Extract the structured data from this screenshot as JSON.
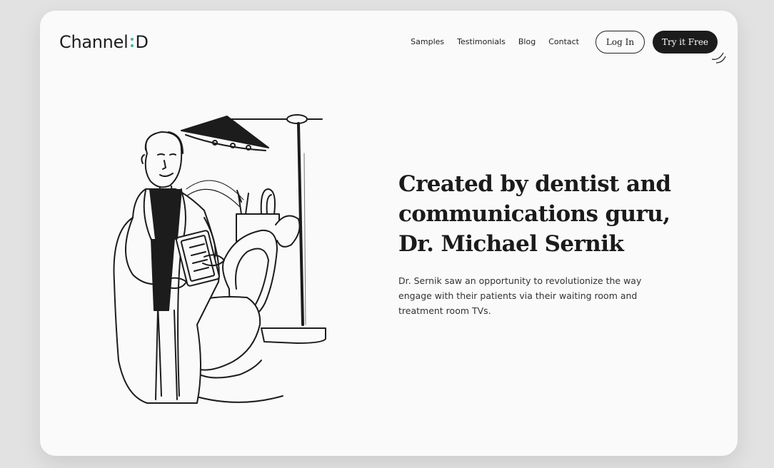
{
  "brand": {
    "name_left": "Channel",
    "name_right": "D",
    "accent_color": "#3fb59b"
  },
  "nav": {
    "items": [
      "Samples",
      "Testimonials",
      "Blog",
      "Contact"
    ]
  },
  "actions": {
    "login_label": "Log In",
    "try_label": "Try it Free"
  },
  "hero": {
    "heading_lines": [
      "Created by dentist and",
      "communications guru,",
      "Dr. Michael Sernik"
    ],
    "body": "Dr. Sernik saw an opportunity to revolutionize the way engage with their patients via their waiting room and treatment room TVs."
  },
  "illustration": {
    "icon": "dentist-with-chair-illustration"
  },
  "colors": {
    "page_bg": "#e2e2e2",
    "card_bg": "#fafafa",
    "ink": "#1c1c1c"
  }
}
